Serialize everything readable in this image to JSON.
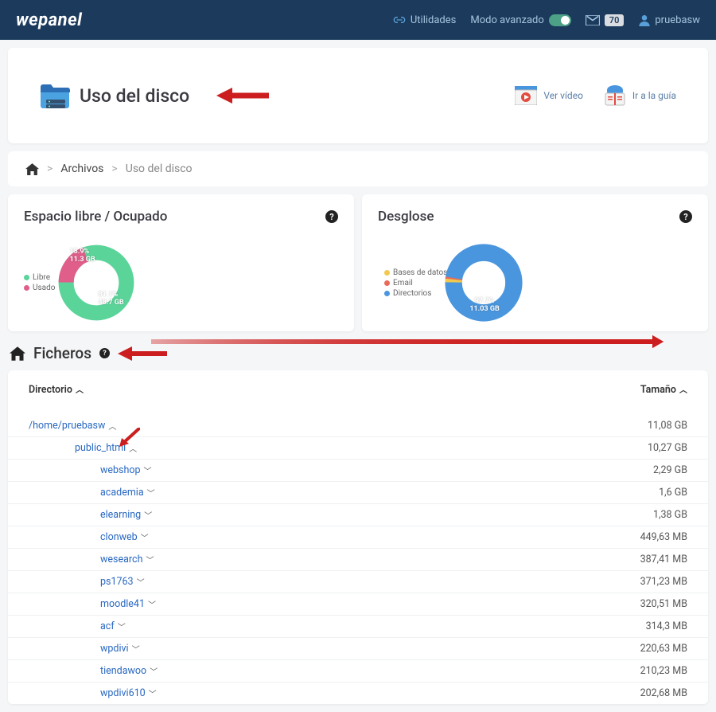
{
  "header": {
    "logo": "wepanel",
    "utilities": "Utilidades",
    "advanced_mode": "Modo avanzado",
    "mail_count": "70",
    "username": "pruebasw"
  },
  "title_card": {
    "title": "Uso del disco",
    "video": "Ver vídeo",
    "guide": "Ir a la guía"
  },
  "breadcrumb": {
    "item1": "Archivos",
    "item2": "Uso del disco"
  },
  "panel_space": {
    "title": "Espacio libre / Ocupado",
    "legend_free": "Libre",
    "legend_used": "Usado",
    "used_pct": "18.9%",
    "used_gb": "11.3 GB",
    "free_pct": "81.1%",
    "free_gb": "48.7 GB"
  },
  "panel_breakdown": {
    "title": "Desglose",
    "legend_db": "Bases de datos",
    "legend_email": "Email",
    "legend_dirs": "Directorios",
    "dirs_pct": "97.7%",
    "dirs_gb": "11.03 GB"
  },
  "ficheros": {
    "title": "Ficheros"
  },
  "files_table": {
    "col_dir": "Directorio",
    "col_size": "Tamaño",
    "root": {
      "name": "/home/pruebasw",
      "size": "11,08 GB"
    },
    "public_html": {
      "name": "public_html",
      "size": "10,27 GB"
    },
    "rows": [
      {
        "name": "webshop",
        "size": "2,29 GB",
        "arrow": true
      },
      {
        "name": "academia",
        "size": "1,6 GB",
        "arrow": true
      },
      {
        "name": "elearning",
        "size": "1,38 GB",
        "arrow": true
      },
      {
        "name": "clonweb",
        "size": "449,63 MB",
        "arrow": false
      },
      {
        "name": "wesearch",
        "size": "387,41 MB",
        "arrow": false
      },
      {
        "name": "ps1763",
        "size": "371,23 MB",
        "arrow": false
      },
      {
        "name": "moodle41",
        "size": "320,51 MB",
        "arrow": false
      },
      {
        "name": "acf",
        "size": "314,3 MB",
        "arrow": false
      },
      {
        "name": "wpdivi",
        "size": "220,63 MB",
        "arrow": false
      },
      {
        "name": "tiendawoo",
        "size": "210,23 MB",
        "arrow": false
      },
      {
        "name": "wpdivi610",
        "size": "202,68 MB",
        "arrow": false
      }
    ]
  },
  "chart_data": [
    {
      "type": "pie",
      "title": "Espacio libre / Ocupado",
      "series": [
        {
          "name": "Libre",
          "value": 48.7,
          "pct": 81.1,
          "color": "#5bd49a"
        },
        {
          "name": "Usado",
          "value": 11.3,
          "pct": 18.9,
          "color": "#e05e8a"
        }
      ],
      "unit": "GB"
    },
    {
      "type": "pie",
      "title": "Desglose",
      "series": [
        {
          "name": "Directorios",
          "value": 11.03,
          "pct": 97.7,
          "color": "#4a96de"
        },
        {
          "name": "Bases de datos",
          "value": 0.18,
          "pct": 1.6,
          "color": "#f2c94c"
        },
        {
          "name": "Email",
          "value": 0.08,
          "pct": 0.7,
          "color": "#e96a5a"
        }
      ],
      "unit": "GB"
    }
  ]
}
